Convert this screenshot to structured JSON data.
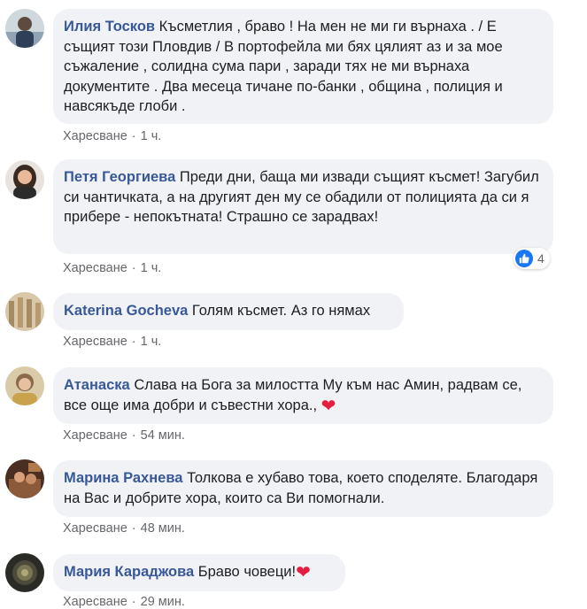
{
  "ui": {
    "like_label": "Харесване",
    "separator": "·"
  },
  "comments": [
    {
      "author": "Илия Тосков",
      "text": "Късметлия , браво ! На мен не ми ги върнаха . / Е същият този Пловдив / В портофейла ми бях цялият аз и за мое съжаление , солидна сума пари , заради тях не ми върнаха документите . Два месеца тичане по-банки , община , полиция и навсякъде глоби .",
      "time": "1 ч."
    },
    {
      "author": "Петя Георгиева",
      "text": "Преди дни, баща ми извади същият късмет! Загубил си чантичката, а на другият ден му се обадили от полицията да си я прибере - непокътната! Страшно се зарадвах!",
      "time": "1 ч.",
      "reaction_count": "4"
    },
    {
      "author": "Katerina Gocheva",
      "text": "Голям късмет. Аз го нямах",
      "time": "1 ч."
    },
    {
      "author": "Атанаска",
      "text": "Слава на Бога за милостта Му към нас Амин, радвам се, все още има добри и съвестни хора.,",
      "time": "54 мин."
    },
    {
      "author": "Марина Рахнева",
      "text": "Толкова е хубаво това, което споделяте. Благодаря на Вас и добрите хора, които са Ви помогнали.",
      "time": "48 мин."
    },
    {
      "author": "Мария Караджова",
      "text": "Браво човеци!",
      "time": "29 мин."
    }
  ],
  "colors": {
    "author": "#385898",
    "bubble": "#f0f2f5",
    "meta": "#65676b",
    "heart": "#e41e3f",
    "like_badge": "#1877f2"
  },
  "icons": {
    "heart": "heart-icon",
    "like": "thumbs-up-icon"
  }
}
